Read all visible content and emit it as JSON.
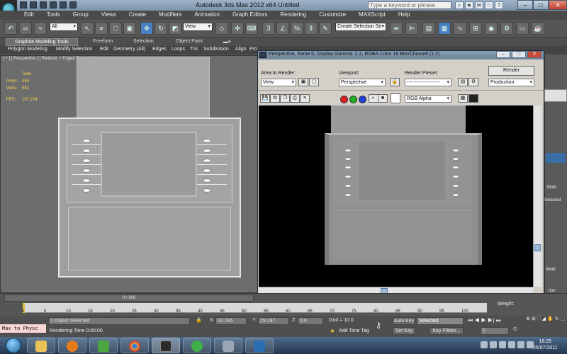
{
  "app": {
    "title": "Autodesk 3ds Max  2012 x64    Untitled",
    "search_placeholder": "Type a keyword or phrase"
  },
  "window_buttons": [
    "–",
    "□",
    "✕"
  ],
  "menu": [
    "Edit",
    "Tools",
    "Group",
    "Views",
    "Create",
    "Modifiers",
    "Animation",
    "Graph Editors",
    "Rendering",
    "Customize",
    "MAXScript",
    "Help"
  ],
  "toolbar": {
    "selection_filter": "All",
    "ref_coord": "View",
    "named_selection": "Create Selection Se"
  },
  "ribbon": {
    "tabs": [
      "Graphite Modeling Tools",
      "Freeform",
      "Selection",
      "Object Paint"
    ],
    "row": [
      "Polygon Modeling",
      "Modify Selection",
      "Edit",
      "Geometry (All)",
      "Edges",
      "Loops",
      "Tris",
      "Subdivision",
      "Align",
      "Pro"
    ]
  },
  "viewport": {
    "label": "[ + ] [ Perspective ] [ Realistic + Edged Faces ]",
    "stats": {
      "total_label": "Total",
      "polys_label": "Polys:",
      "polys_value": "385",
      "verts_label": "Verts:",
      "verts_value": "582",
      "fps_label": "FPS:",
      "fps_value": "197.274"
    }
  },
  "render_window": {
    "title": "Perspective, frame 0, Display Gamma: 2.2, RGBA Color 16 Bits/Channel (1:2)",
    "area_label": "Area to Render:",
    "area_value": "View",
    "viewport_label": "Viewport:",
    "viewport_value": "Perspective",
    "preset_label": "Render Preset:",
    "preset_value": "--------------------",
    "render_button": "Render",
    "production_value": "Production",
    "channel_value": "RGB Alpha",
    "colors": {
      "red": "#e02020",
      "green": "#20b020",
      "blue": "#2040e0"
    }
  },
  "command_panel": {
    "multi": "Multi",
    "selected": "Selected",
    "weld": "Weld",
    "tion": "tion"
  },
  "timeline": {
    "slider": "0 / 100",
    "ticks": [
      "0",
      "5",
      "10",
      "15",
      "20",
      "25",
      "30",
      "35",
      "40",
      "45",
      "50",
      "55",
      "60",
      "65",
      "70",
      "75",
      "80",
      "85",
      "90",
      "95",
      "100"
    ]
  },
  "status": {
    "maxscript": "Max to Physc",
    "selected_text": "1 Object Selected",
    "render_time": "Rendering Time  0:00:00",
    "x_label": "X:",
    "x_value": "92.285",
    "y_label": "Y:",
    "y_value": "29.297",
    "z_label": "Z:",
    "z_value": "0.0",
    "grid": "Grid = 10.0",
    "add_time_tag": "Add Time Tag",
    "auto_key": "Auto Key",
    "key_mode": "Selected",
    "set_key": "Set Key",
    "key_filters": "Key Filters...",
    "frame_value": "0",
    "weight_label": "Weight:"
  },
  "taskbar": {
    "time": "16:25",
    "date": "25/07/2011"
  }
}
